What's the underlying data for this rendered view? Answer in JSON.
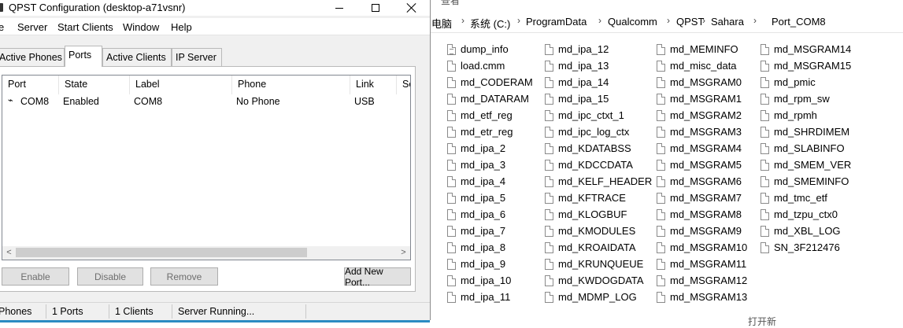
{
  "explorer": {
    "top_partial": "查看",
    "breadcrumb": [
      "电脑",
      "系统 (C:)",
      "ProgramData",
      "Qualcomm",
      "QPST",
      "Sahara",
      "Port_COM8"
    ],
    "files_col1": [
      "dump_info",
      "load.cmm",
      "md_CODERAM",
      "md_DATARAM",
      "md_etf_reg",
      "md_etr_reg",
      "md_ipa_2",
      "md_ipa_3",
      "md_ipa_4",
      "md_ipa_5",
      "md_ipa_6",
      "md_ipa_7",
      "md_ipa_8",
      "md_ipa_9",
      "md_ipa_10",
      "md_ipa_11"
    ],
    "files_col2": [
      "md_ipa_12",
      "md_ipa_13",
      "md_ipa_14",
      "md_ipa_15",
      "md_ipc_ctxt_1",
      "md_ipc_log_ctx",
      "md_KDATABSS",
      "md_KDCCDATA",
      "md_KELF_HEADER",
      "md_KFTRACE",
      "md_KLOGBUF",
      "md_KMODULES",
      "md_KROAIDATA",
      "md_KRUNQUEUE",
      "md_KWDOGDATA",
      "md_MDMP_LOG"
    ],
    "files_col3": [
      "md_MEMINFO",
      "md_misc_data",
      "md_MSGRAM0",
      "md_MSGRAM1",
      "md_MSGRAM2",
      "md_MSGRAM3",
      "md_MSGRAM4",
      "md_MSGRAM5",
      "md_MSGRAM6",
      "md_MSGRAM7",
      "md_MSGRAM8",
      "md_MSGRAM9",
      "md_MSGRAM10",
      "md_MSGRAM11",
      "md_MSGRAM12",
      "md_MSGRAM13"
    ],
    "files_col4": [
      "md_MSGRAM14",
      "md_MSGRAM15",
      "md_pmic",
      "md_rpm_sw",
      "md_rpmh",
      "md_SHRDIMEM",
      "md_SLABINFO",
      "md_SMEM_VER",
      "md_SMEMINFO",
      "md_tmc_etf",
      "md_tzpu_ctx0",
      "md_XBL_LOG",
      "SN_3F212476"
    ],
    "bottom_partial": "打开新"
  },
  "qpst": {
    "title": "QPST Configuration (desktop-a71vsnr)",
    "menu": [
      "e",
      "Server",
      "Start Clients",
      "Window",
      "Help"
    ],
    "tabs": [
      "Active Phones",
      "Ports",
      "Active Clients",
      "IP Server"
    ],
    "active_tab": "Ports",
    "columns": [
      "Port",
      "State",
      "Label",
      "Phone",
      "Link",
      "Se"
    ],
    "rows": [
      {
        "port": "COM8",
        "state": "Enabled",
        "label": "COM8",
        "phone": "No Phone",
        "link": "USB"
      }
    ],
    "buttons": {
      "enable": "Enable",
      "disable": "Disable",
      "remove": "Remove",
      "add_new_port": "Add New Port..."
    },
    "status": {
      "phones": "Phones",
      "ports": "1 Ports",
      "clients": "1 Clients",
      "server": "Server Running..."
    }
  }
}
